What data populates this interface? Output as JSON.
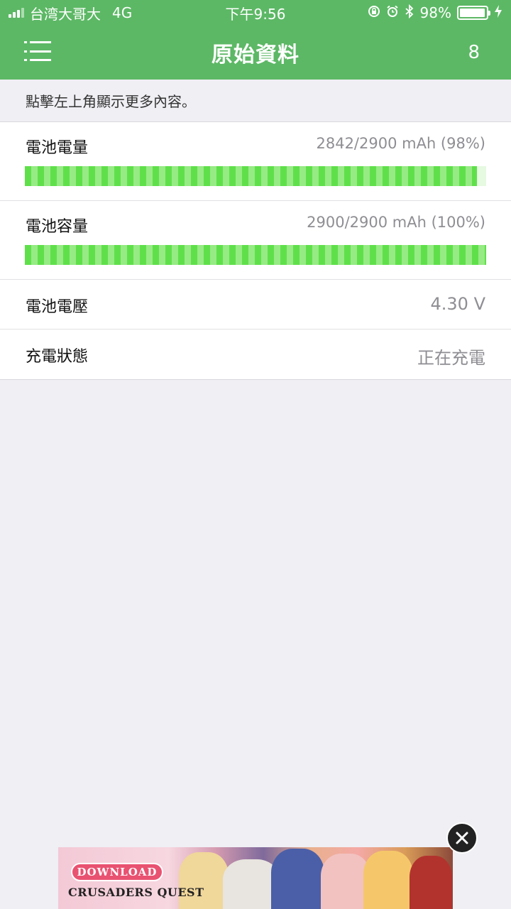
{
  "status_bar": {
    "carrier": "台湾大哥大",
    "network": "4G",
    "time": "下午9:56",
    "battery_percent": "98%",
    "battery_level": 0.98,
    "icons": [
      "signal-icon",
      "orientation-lock-icon",
      "alarm-icon",
      "bluetooth-icon",
      "battery-icon",
      "charging-bolt-icon"
    ]
  },
  "nav": {
    "title": "原始資料",
    "count": "8",
    "menu_icon": "menu-icon"
  },
  "hint": "點擊左上角顯示更多內容。",
  "rows": [
    {
      "label": "電池電量",
      "value": "2842/2900 mAh (98%)",
      "progress": 0.98
    },
    {
      "label": "電池容量",
      "value": "2900/2900 mAh (100%)",
      "progress": 1.0
    },
    {
      "label": "電池電壓",
      "value": "4.30 V"
    },
    {
      "label": "充電狀態",
      "value": "正在充電"
    }
  ],
  "ad": {
    "button_label": "DOWNLOAD",
    "brand": "CRUSADERS QUEST",
    "close_icon": "close-icon"
  },
  "colors": {
    "accent": "#5cb865",
    "progress_stripe_a": "#5fe04a",
    "progress_stripe_b": "#96eb84",
    "background": "#efeff4"
  }
}
